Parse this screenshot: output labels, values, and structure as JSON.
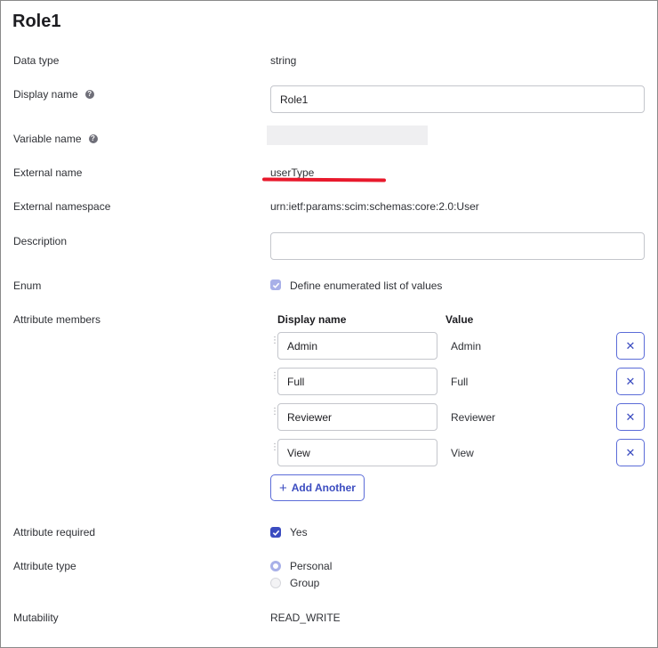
{
  "title": "Role1",
  "fields": {
    "data_type": {
      "label": "Data type",
      "value": "string"
    },
    "display_name": {
      "label": "Display name",
      "value": "Role1"
    },
    "variable_name": {
      "label": "Variable name"
    },
    "external_name": {
      "label": "External name",
      "value": "userType"
    },
    "external_namespace": {
      "label": "External namespace",
      "value": "urn:ietf:params:scim:schemas:core:2.0:User"
    },
    "description": {
      "label": "Description",
      "value": ""
    },
    "enum": {
      "label": "Enum",
      "checkbox_label": "Define enumerated list of values",
      "checked": true
    },
    "attribute_members": {
      "label": "Attribute members",
      "col_display_name": "Display name",
      "col_value": "Value",
      "members": [
        {
          "display_name": "Admin",
          "value": "Admin"
        },
        {
          "display_name": "Full",
          "value": "Full"
        },
        {
          "display_name": "Reviewer",
          "value": "Reviewer"
        },
        {
          "display_name": "View",
          "value": "View"
        }
      ],
      "add_label": "Add Another"
    },
    "attribute_required": {
      "label": "Attribute required",
      "checkbox_label": "Yes",
      "checked": true
    },
    "attribute_type": {
      "label": "Attribute type",
      "options": [
        "Personal",
        "Group"
      ],
      "selected": "Personal"
    },
    "mutability": {
      "label": "Mutability",
      "value": "READ_WRITE"
    }
  },
  "colors": {
    "accent": "#5b6cd8",
    "enum_checkbox": "#a8b0e8",
    "highlight": "#e8192c"
  },
  "icons": {
    "help": "question-icon",
    "remove": "close-icon",
    "drag": "drag-handle-icon",
    "add": "plus-icon"
  }
}
